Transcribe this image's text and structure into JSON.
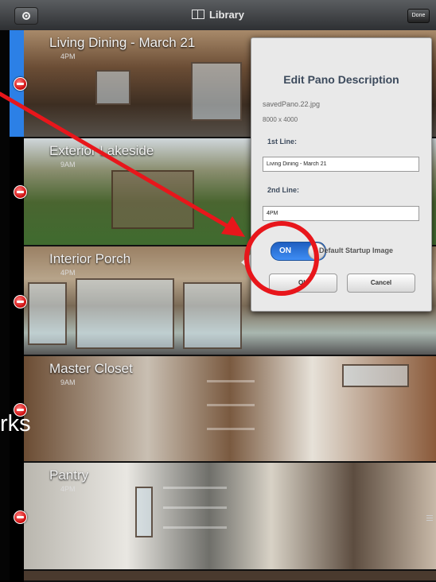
{
  "toolbar": {
    "title": "Library",
    "done_label": "Done"
  },
  "rows": [
    {
      "label": "Living Dining - March 21",
      "time": "4PM"
    },
    {
      "label": "Exterior Lakeside",
      "time": "9AM"
    },
    {
      "label": "Interior Porch",
      "time": "4PM"
    },
    {
      "label": "Master Closet",
      "time": "9AM"
    },
    {
      "label": "Pantry",
      "time": "4PM"
    }
  ],
  "panel": {
    "title": "Edit Pano Description",
    "filename": "savedPano.22.jpg",
    "dimensions": "8000 x 4000",
    "line1_label": "1st Line:",
    "line1_value": "Living Dining - March 21",
    "line2_label": "2nd Line:",
    "line2_value": "4PM",
    "toggle_state": "ON",
    "default_label": "Default Startup Image",
    "ok_label": "OK",
    "cancel_label": "Cancel"
  },
  "annotation": {
    "text_fragment": "rks",
    "color": "#e8161b"
  },
  "colors": {
    "accent": "#2c80e6",
    "delete": "#d11212"
  }
}
